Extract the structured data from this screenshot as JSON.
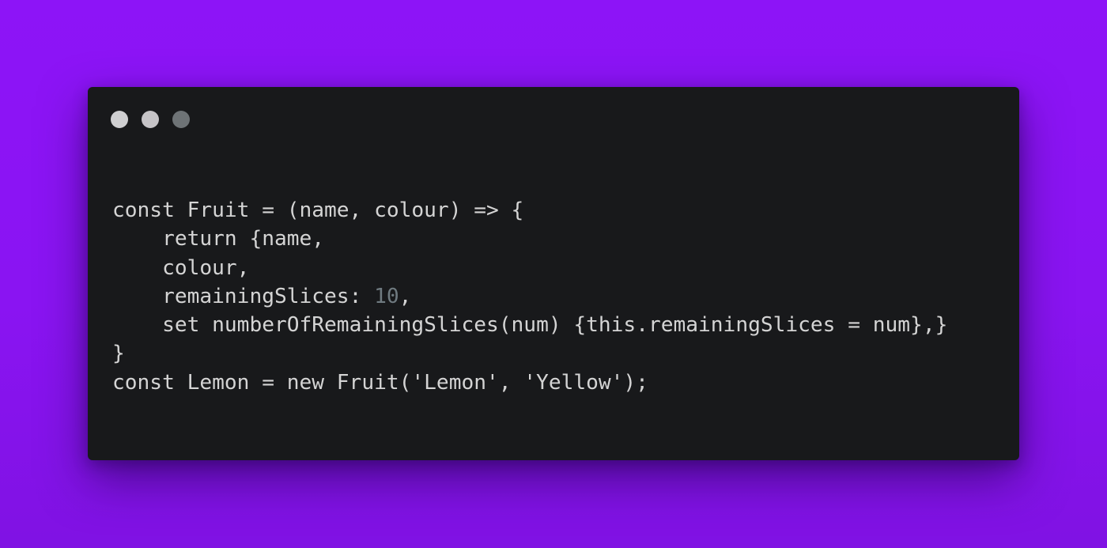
{
  "window": {
    "controls": [
      {
        "name": "close",
        "color": "#cfcfd1"
      },
      {
        "name": "minimize",
        "color": "#c6c4c7"
      },
      {
        "name": "zoom",
        "color": "#6e7376"
      }
    ]
  },
  "code": {
    "lines": [
      {
        "indent": "",
        "text": "const Fruit = (name, colour) => {",
        "number": "",
        "rest": ""
      },
      {
        "indent": "    ",
        "text": "return {name,",
        "number": "",
        "rest": ""
      },
      {
        "indent": "    ",
        "text": "colour,",
        "number": "",
        "rest": ""
      },
      {
        "indent": "    ",
        "text": "remainingSlices: ",
        "number": "10",
        "rest": ","
      },
      {
        "indent": "    ",
        "text": "set numberOfRemainingSlices(num) {this.remainingSlices = num},}",
        "number": "",
        "rest": ""
      },
      {
        "indent": "",
        "text": "}",
        "number": "",
        "rest": ""
      },
      {
        "indent": "",
        "text": "const Lemon = new Fruit('Lemon', 'Yellow');",
        "number": "",
        "rest": ""
      }
    ]
  },
  "colors": {
    "background": "#8c14f5",
    "editor": "#18191b",
    "text": "#d4d4d4",
    "number": "#6f7a80"
  }
}
